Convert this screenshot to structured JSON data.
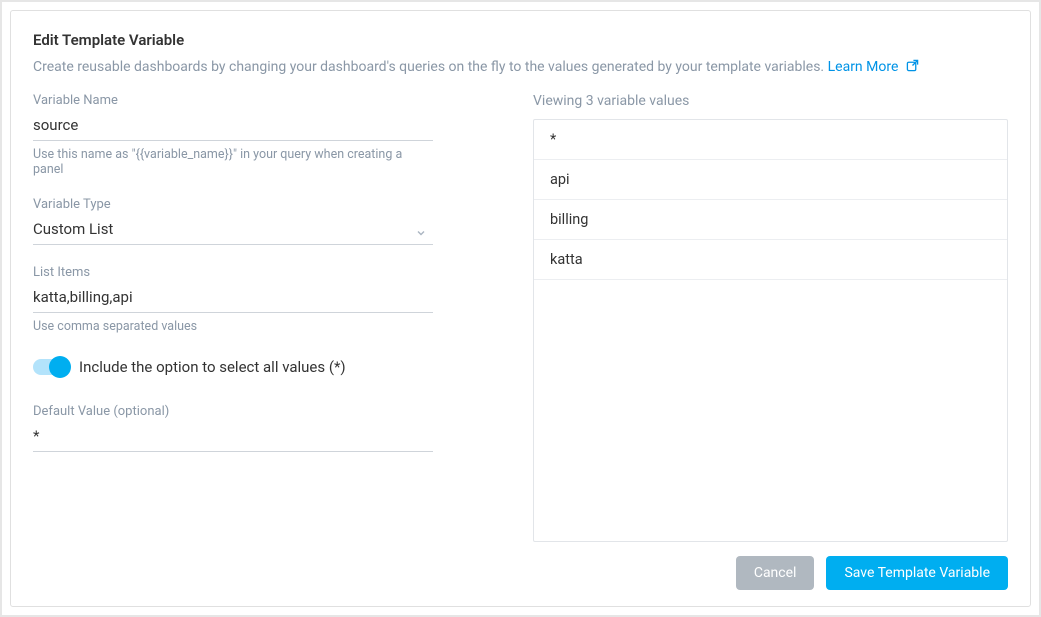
{
  "header": {
    "title": "Edit Template Variable",
    "description": "Create reusable dashboards by changing your dashboard's queries on the fly to the values generated by your template variables.",
    "learn_more": "Learn More"
  },
  "left": {
    "name": {
      "label": "Variable Name",
      "value": "source",
      "helper": "Use this name as \"{{variable_name}}\" in your query when creating a panel"
    },
    "type": {
      "label": "Variable Type",
      "value": "Custom List"
    },
    "items": {
      "label": "List Items",
      "value": "katta,billing,api",
      "helper": "Use comma separated values"
    },
    "toggle": {
      "label": "Include the option to select all values (*)",
      "on": true
    },
    "default": {
      "label": "Default Value (optional)",
      "value": "*"
    }
  },
  "right": {
    "header": "Viewing 3 variable values",
    "values": [
      "*",
      "api",
      "billing",
      "katta"
    ]
  },
  "footer": {
    "cancel": "Cancel",
    "save": "Save Template Variable"
  }
}
